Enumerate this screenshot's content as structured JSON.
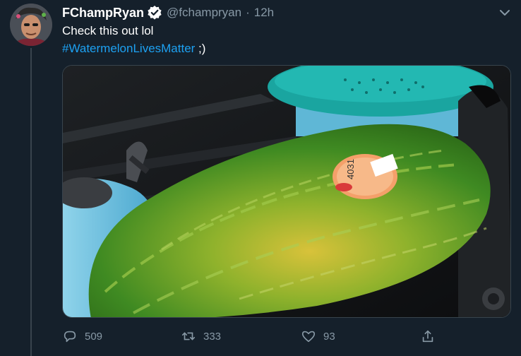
{
  "tweet": {
    "display_name": "FChampRyan",
    "handle": "@fchampryan",
    "separator": "·",
    "time": "12h",
    "text_line1": "Check this out lol",
    "hashtag": "#WatermelonLivesMatter",
    "text_after_hashtag": " ;)",
    "sticker_text": "4031"
  },
  "actions": {
    "replies": "509",
    "retweets": "333",
    "likes": "93"
  },
  "icons": {
    "verified": "verified-badge-icon",
    "menu": "chevron-down-icon",
    "reply": "reply-icon",
    "retweet": "retweet-icon",
    "like": "heart-icon",
    "share": "share-icon"
  },
  "colors": {
    "background": "#15202b",
    "muted": "#8899a6",
    "link": "#1da1f2",
    "divider": "#38444d",
    "watermelon_green": "#3f8a22",
    "colander_teal": "#1aa5a0",
    "kettle_blue": "#6cc0e0"
  }
}
